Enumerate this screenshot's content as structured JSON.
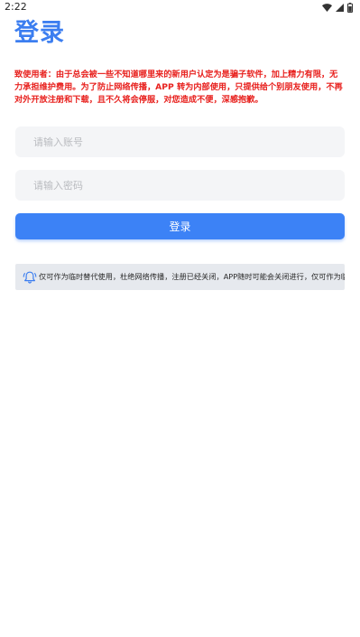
{
  "status_bar": {
    "time": "2:22",
    "icons": [
      "wifi-icon",
      "signal-icon",
      "battery-icon"
    ]
  },
  "page": {
    "title": "登录",
    "notice": "致使用者：由于总会被一些不知道哪里来的新用户认定为是骗子软件，加上精力有限，无力承担维护费用。为了防止网络传播，APP 转为内部使用，只提供给个别朋友使用，不再对外开放注册和下载，且不久将会停服，对您造成不便，深感抱歉。"
  },
  "form": {
    "account_placeholder": "请输入账号",
    "account_value": "",
    "password_placeholder": "请输入密码",
    "password_value": "",
    "login_label": "登录"
  },
  "notice_bar": {
    "icon": "bell-icon",
    "text": "仅可作为临时替代使用，杜绝网络传播，注册已经关闭，APP随时可能会关闭进行，仅可作为临时替"
  },
  "colors": {
    "accent": "#3c7ef0",
    "button": "#3c82f6",
    "warning": "#e8221f",
    "input_bg": "#f4f5f7",
    "notice_bar_bg": "#e6e9ee"
  }
}
